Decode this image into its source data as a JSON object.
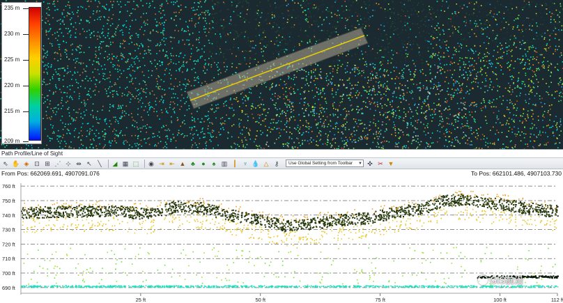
{
  "legend": {
    "labels": [
      "235 m",
      "230 m",
      "225 m",
      "220 m",
      "215 m",
      "209 m"
    ]
  },
  "panel": {
    "title": "Path Profile/Line of Sight"
  },
  "toolbar": {
    "setting_select": "Use Global Setting from Toolbar",
    "icons": [
      "select-icon",
      "pan-hand-icon",
      "measure-icon",
      "zoom-box-icon",
      "fit-icon",
      "profile-icon",
      "grid-icon",
      "spacing-icon",
      "cursor-icon",
      "ruler-icon",
      "line-icon",
      "area-icon",
      "export-icon",
      "eye-icon",
      "arrow-icon",
      "align-icon",
      "terrain-icon",
      "tree-icon",
      "tree-round-icon",
      "tree-cone-icon",
      "building-icon",
      "pole-icon",
      "antenna-icon",
      "water-icon",
      "hazard-icon",
      "key-icon",
      "crosshair-icon",
      "scissors-icon",
      "filter-icon"
    ]
  },
  "positions": {
    "from": "From Pos: 662069.691, 4907091.076",
    "to": "To Pos: 662101.486, 4907103.730"
  },
  "chart_data": {
    "type": "scatter",
    "y_ticks": [
      "760 ft",
      "750 ft",
      "740 ft",
      "730 ft",
      "720 ft",
      "710 ft",
      "700 ft",
      "690 ft"
    ],
    "x_ticks": [
      "25 ft",
      "50 ft",
      "75 ft",
      "100 ft",
      "112 ft"
    ],
    "xlim": [
      0,
      112
    ],
    "ylim": [
      688,
      762
    ],
    "grid": true
  },
  "watermark": {
    "text": "GIS前沿"
  }
}
